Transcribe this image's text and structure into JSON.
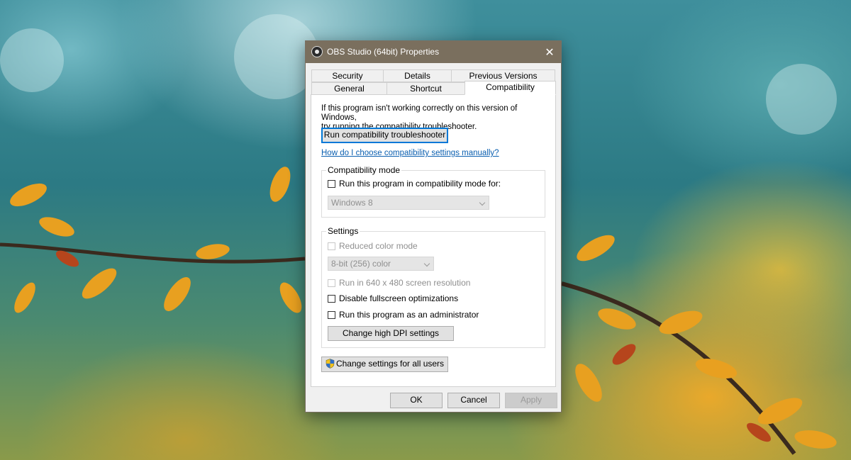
{
  "window": {
    "title": "OBS Studio (64bit) Properties",
    "close_glyph": "✕"
  },
  "tabs": {
    "row1": [
      "Security",
      "Details",
      "Previous Versions"
    ],
    "row2": [
      "General",
      "Shortcut",
      "Compatibility"
    ],
    "active": "Compatibility"
  },
  "intro": {
    "line1": "If this program isn't working correctly on this version of Windows,",
    "line2": "try running the compatibility troubleshooter."
  },
  "troubleshooter_button": "Run compatibility troubleshooter",
  "help_link": "How do I choose compatibility settings manually?",
  "compat_mode": {
    "label": "Compatibility mode",
    "checkbox": "Run this program in compatibility mode for:",
    "selected_os": "Windows 8"
  },
  "settings": {
    "label": "Settings",
    "reduced_color": "Reduced color mode",
    "color_depth": "8-bit (256) color",
    "low_res": "Run in 640 x 480 screen resolution",
    "disable_fullscreen": "Disable fullscreen optimizations",
    "run_as_admin": "Run this program as an administrator",
    "dpi_button": "Change high DPI settings"
  },
  "all_users_button": "Change settings for all users",
  "footer": {
    "ok": "OK",
    "cancel": "Cancel",
    "apply": "Apply"
  },
  "colors": {
    "titlebar": "#7a6f5e",
    "focus_border": "#0078d7",
    "link": "#0b5fb0"
  },
  "icons": [
    "obs-app-icon",
    "close-icon",
    "uac-shield-icon",
    "chevron-down-icon"
  ]
}
